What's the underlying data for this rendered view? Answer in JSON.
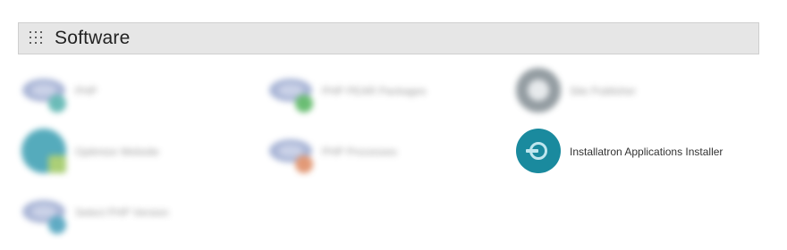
{
  "section": {
    "title": "Software",
    "icon": "grid-dots-icon"
  },
  "items": [
    {
      "label": "PHP",
      "icon": "php-icon"
    },
    {
      "label": "PHP PEAR Packages",
      "icon": "php-pear-packages-icon"
    },
    {
      "label": "Site Publisher",
      "icon": "site-publisher-icon"
    },
    {
      "label": "Optimize Website",
      "icon": "optimize-website-icon"
    },
    {
      "label": "PHP Processes",
      "icon": "php-processes-icon"
    },
    {
      "label": "Installatron Applications Installer",
      "icon": "installatron-icon"
    },
    {
      "label": "Select PHP Version",
      "icon": "select-php-version-icon"
    }
  ],
  "colors": {
    "header_bg": "#e6e6e6",
    "installatron_teal": "#1a8a9e"
  }
}
